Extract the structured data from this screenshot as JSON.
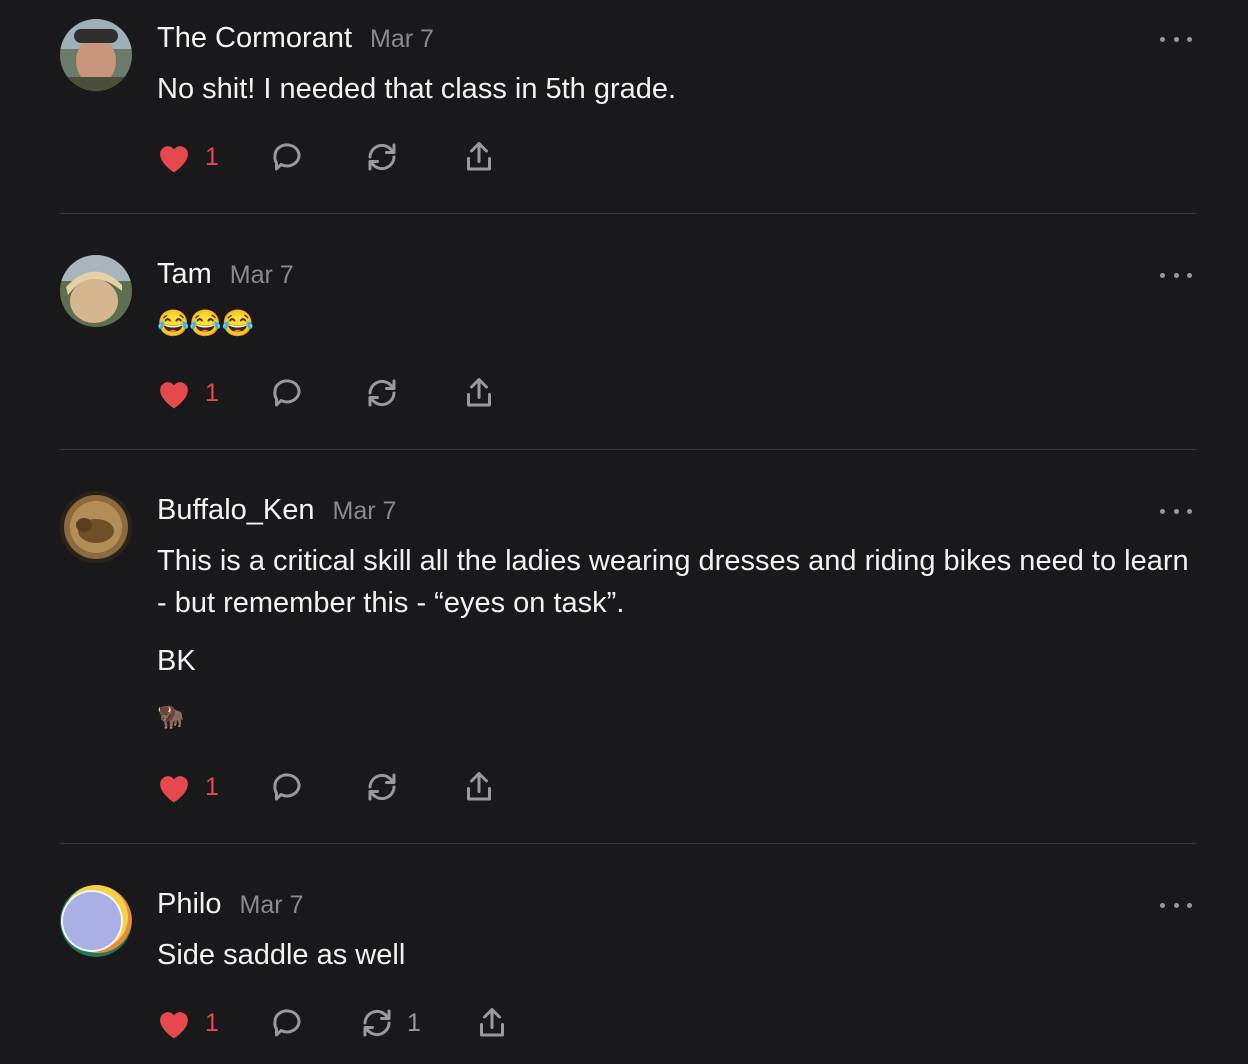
{
  "colors": {
    "background": "#19191b",
    "like": "#e5484d",
    "muted": "#8b8b8f",
    "divider": "#3a3a3d"
  },
  "icons": {
    "like": "heart-icon",
    "reply": "speech-bubble-icon",
    "restack": "refresh-icon",
    "share": "share-upload-icon",
    "more": "ellipsis-icon"
  },
  "comments": [
    {
      "author": "The Cormorant",
      "date": "Mar 7",
      "text": "No shit! I needed that class in 5th grade.",
      "likes": "1"
    },
    {
      "author": "Tam",
      "date": "Mar 7",
      "text": "😂😂😂",
      "likes": "1"
    },
    {
      "author": "Buffalo_Ken",
      "date": "Mar 7",
      "text": "This is a critical skill all the ladies wearing dresses and riding bikes need to learn - but remember this - “eyes on task”.",
      "text2": "BK",
      "text3": "🦬",
      "likes": "1"
    },
    {
      "author": "Philo",
      "date": "Mar 7",
      "text": "Side saddle as well",
      "likes": "1",
      "restacks": "1"
    }
  ]
}
